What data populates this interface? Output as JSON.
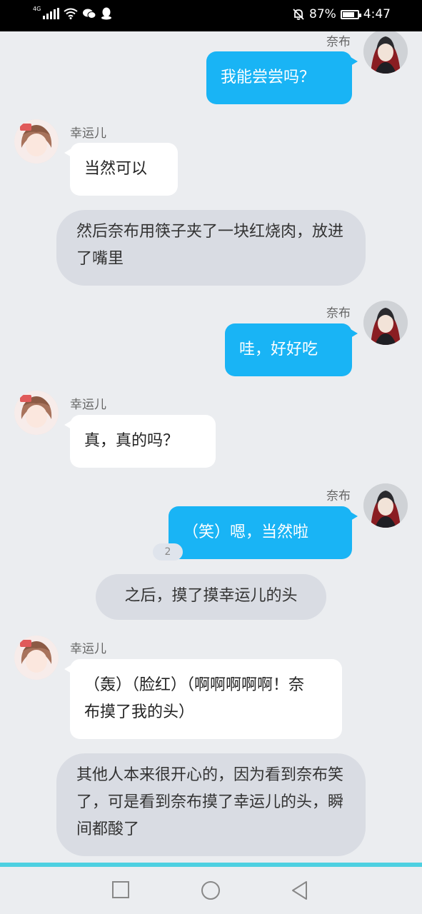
{
  "status_bar": {
    "network": "4G",
    "battery_percent": "87%",
    "battery_level": 0.87,
    "time": "4:47"
  },
  "messages": [
    {
      "type": "me",
      "name": "奈布",
      "text": "我能尝尝吗？"
    },
    {
      "type": "other",
      "name": "幸运儿",
      "text": "当然可以"
    },
    {
      "type": "narration",
      "text": "然后奈布用筷子夹了一块红烧肉，放进了嘴里"
    },
    {
      "type": "me",
      "name": "奈布",
      "text": "哇，好好吃"
    },
    {
      "type": "other",
      "name": "幸运儿",
      "text": "真，真的吗？"
    },
    {
      "type": "me",
      "name": "奈布",
      "text": "（笑）嗯，当然啦",
      "badge": "2"
    },
    {
      "type": "narration",
      "text": "之后，摸了摸幸运儿的头"
    },
    {
      "type": "other",
      "name": "幸运儿",
      "text": "（轰）（脸红）（啊啊啊啊啊！奈布摸了我的头）"
    },
    {
      "type": "narration",
      "text": "其他人本来很开心的，因为看到奈布笑了，可是看到奈布摸了幸运儿的头，瞬间都酸了"
    }
  ],
  "colors": {
    "my_bubble": "#19b4f5",
    "other_bubble": "#ffffff",
    "narration_bubble": "#d9dce3",
    "background": "#ebedf0",
    "accent_bar": "#4dd0e1"
  }
}
